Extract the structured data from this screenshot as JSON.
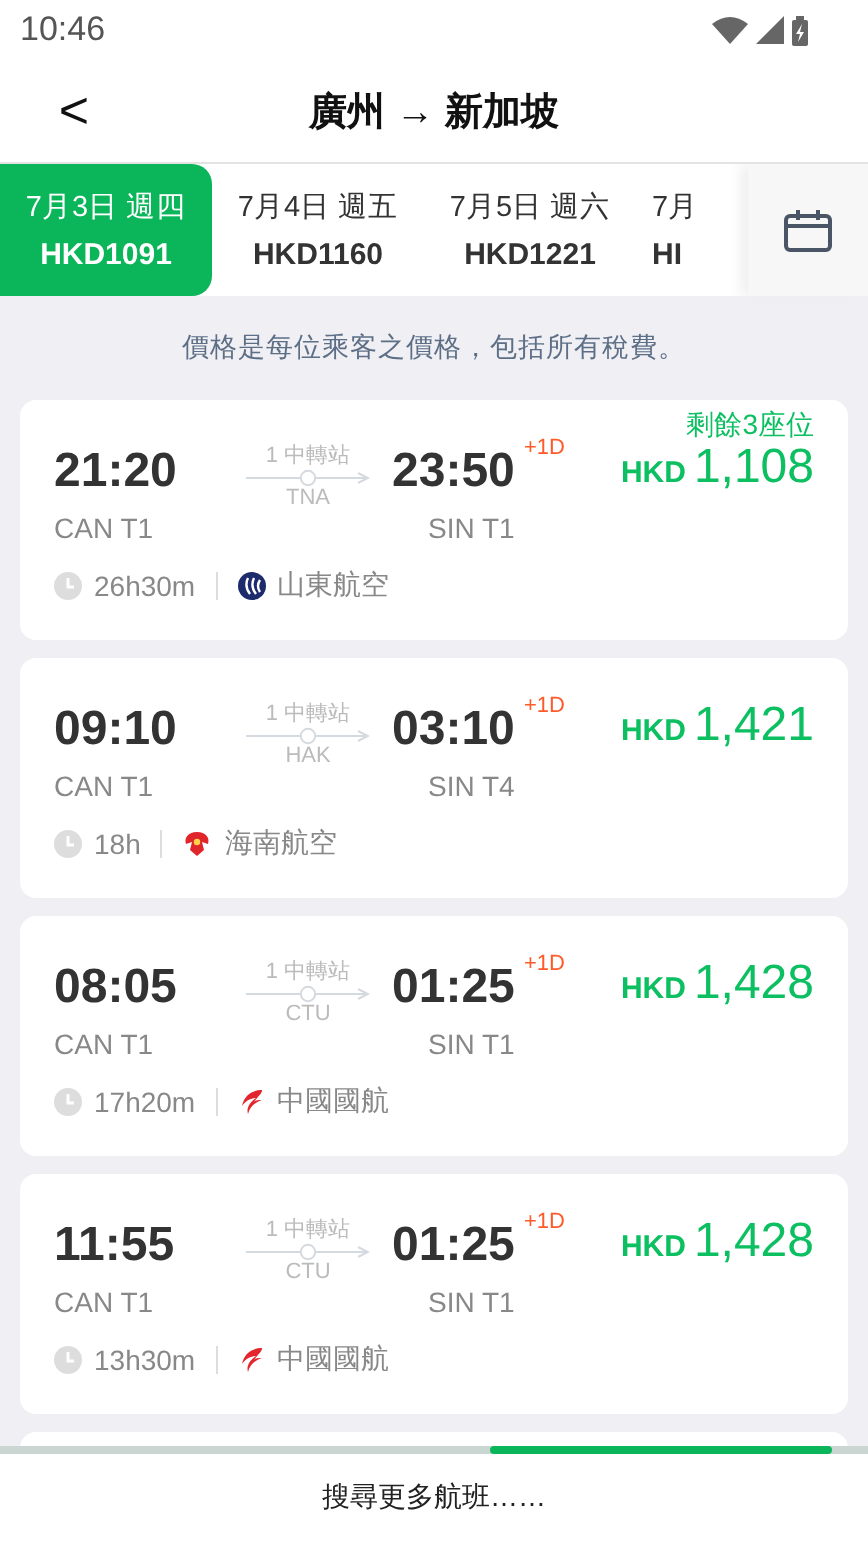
{
  "status_bar": {
    "time": "10:46"
  },
  "header": {
    "back": "<",
    "title": "廣州 → 新加坡"
  },
  "dates": [
    {
      "date": "7月3日 週四",
      "price": "HKD1091",
      "selected": true
    },
    {
      "date": "7月4日 週五",
      "price": "HKD1160",
      "selected": false
    },
    {
      "date": "7月5日 週六",
      "price": "HKD1221",
      "selected": false
    },
    {
      "date": "7月",
      "price": "HI",
      "selected": false
    }
  ],
  "note": "價格是每位乘客之價格，包括所有稅費。",
  "flights": [
    {
      "depart": "21:20",
      "depart_airport": "CAN T1",
      "stops": "1 中轉站",
      "via": "TNA",
      "arrive": "23:50",
      "day_offset": "+1D",
      "arrive_airport": "SIN T1",
      "currency": "HKD",
      "price": "1,108",
      "seats_left": "剩餘3座位",
      "duration": "26h30m",
      "airline": {
        "name": "山東航空",
        "kind": "swirl"
      }
    },
    {
      "depart": "09:10",
      "depart_airport": "CAN T1",
      "stops": "1 中轉站",
      "via": "HAK",
      "arrive": "03:10",
      "day_offset": "+1D",
      "arrive_airport": "SIN T4",
      "currency": "HKD",
      "price": "1,421",
      "duration": "18h",
      "airline": {
        "name": "海南航空",
        "kind": "wings"
      }
    },
    {
      "depart": "08:05",
      "depart_airport": "CAN T1",
      "stops": "1 中轉站",
      "via": "CTU",
      "arrive": "01:25",
      "day_offset": "+1D",
      "arrive_airport": "SIN T1",
      "currency": "HKD",
      "price": "1,428",
      "duration": "17h20m",
      "airline": {
        "name": "中國國航",
        "kind": "phoenix"
      }
    },
    {
      "depart": "11:55",
      "depart_airport": "CAN T1",
      "stops": "1 中轉站",
      "via": "CTU",
      "arrive": "01:25",
      "day_offset": "+1D",
      "arrive_airport": "SIN T1",
      "currency": "HKD",
      "price": "1,428",
      "duration": "13h30m",
      "airline": {
        "name": "中國國航",
        "kind": "phoenix"
      }
    }
  ],
  "more_button": "搜尋更多航班……"
}
